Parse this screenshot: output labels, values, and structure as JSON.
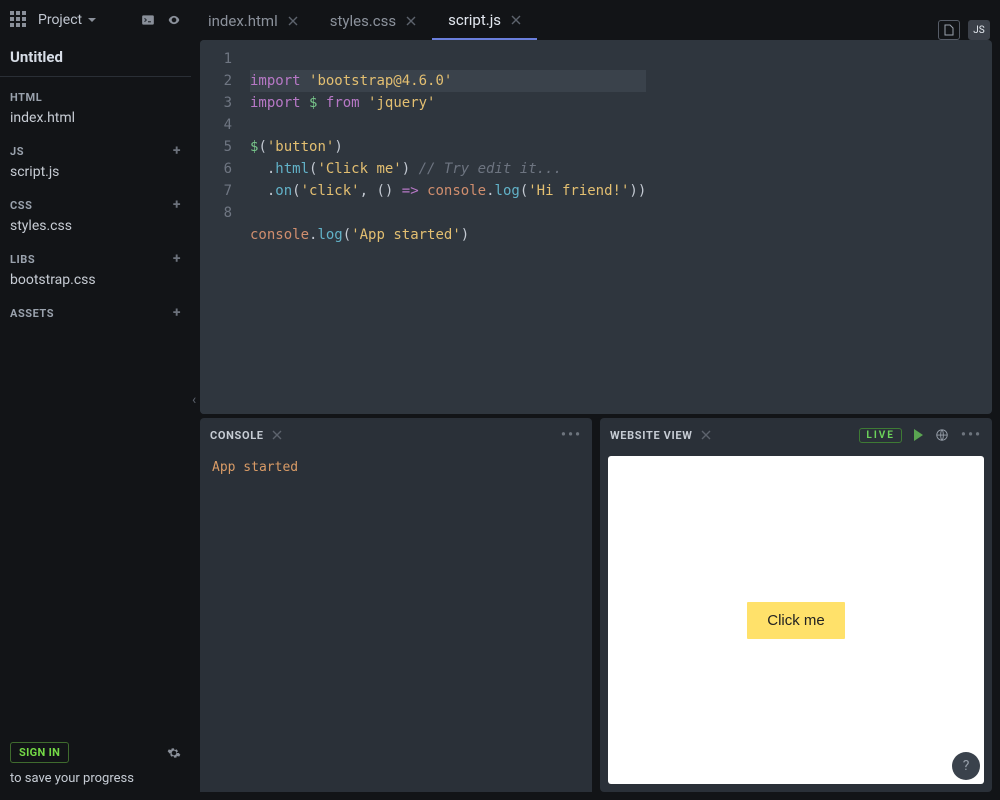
{
  "sidebar": {
    "project_label": "Project",
    "title": "Untitled",
    "sections": {
      "html": {
        "head": "HTML",
        "items": [
          "index.html"
        ]
      },
      "js": {
        "head": "JS",
        "items": [
          "script.js"
        ]
      },
      "css": {
        "head": "CSS",
        "items": [
          "styles.css"
        ]
      },
      "libs": {
        "head": "LIBS",
        "items": [
          "bootstrap.css"
        ]
      },
      "assets": {
        "head": "ASSETS",
        "items": []
      }
    },
    "signin": "SIGN IN",
    "save_progress": "to save your progress"
  },
  "tabs": [
    {
      "label": "index.html",
      "active": false
    },
    {
      "label": "styles.css",
      "active": false
    },
    {
      "label": "script.js",
      "active": true
    }
  ],
  "right_badges": {
    "doc_icon": "doc",
    "lang": "JS"
  },
  "editor": {
    "line_numbers": [
      "1",
      "2",
      "3",
      "4",
      "5",
      "6",
      "7",
      "8"
    ]
  },
  "code": {
    "l1": {
      "import": "import",
      "str": "'bootstrap@4.6.0'"
    },
    "l2": {
      "import": "import",
      "dollar": "$",
      "from": "from",
      "str": "'jquery'"
    },
    "l4": {
      "dollar": "$",
      "open": "(",
      "str": "'button'",
      "close": ")"
    },
    "l5": {
      "dot": ".",
      "html": "html",
      "open": "(",
      "str": "'Click me'",
      "close": ")",
      "comment": "// Try edit it..."
    },
    "l6": {
      "dot": ".",
      "on": "on",
      "open": "(",
      "str1": "'click'",
      "comma": ", ",
      "arrow_open": "()",
      "arrow": "=>",
      "console": "console",
      "dot2": ".",
      "log": "log",
      "open2": "(",
      "str2": "'Hi friend!'",
      "close2": ")",
      "close3": ")"
    },
    "l8": {
      "console": "console",
      "dot": ".",
      "log": "log",
      "open": "(",
      "str": "'App started'",
      "close": ")"
    }
  },
  "console": {
    "title": "CONSOLE",
    "output": "App started"
  },
  "website_view": {
    "title": "WEBSITE VIEW",
    "live": "LIVE",
    "button_text": "Click me"
  },
  "help": "?"
}
